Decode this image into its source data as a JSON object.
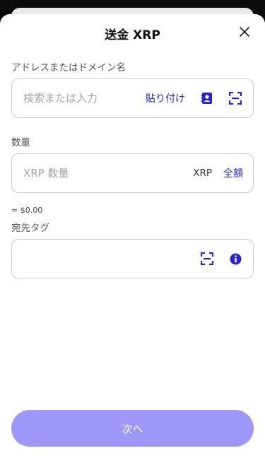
{
  "header": {
    "title": "送金 XRP"
  },
  "address": {
    "label": "アドレスまたはドメイン名",
    "placeholder": "検索または入力",
    "paste_label": "貼り付け",
    "contacts_icon": "contacts-icon",
    "scan_icon": "qr-scan-icon"
  },
  "amount": {
    "label": "数量",
    "placeholder": "XRP 数量",
    "unit": "XRP",
    "max_label": "全額",
    "fiat_estimate": "≈ $0.00"
  },
  "destination_tag": {
    "label": "宛先タグ",
    "value": "",
    "scan_icon": "qr-scan-icon",
    "info_icon": "info-icon"
  },
  "footer": {
    "next_label": "次へ"
  },
  "colors": {
    "accent": "#2424d6",
    "button_disabled": "#9d98f8",
    "border": "#c9c9ce"
  }
}
